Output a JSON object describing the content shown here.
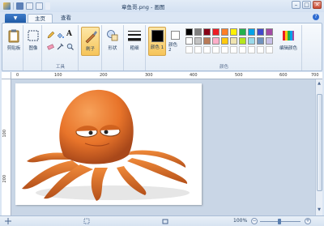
{
  "window": {
    "title": "章鱼哥.png - 画图",
    "minimize": "–",
    "maximize": "□",
    "close": "✕"
  },
  "ribbon_tabs": {
    "app_menu": "▼",
    "tabs": [
      "主页",
      "查看"
    ],
    "active": "主页",
    "help": "?"
  },
  "ribbon": {
    "clipboard": {
      "label": "剪贴板"
    },
    "image": {
      "label": "图像"
    },
    "tools": {
      "group_label": "工具",
      "text_tool": "A"
    },
    "brushes": {
      "label": "刷子"
    },
    "shapes": {
      "label": "形状"
    },
    "size": {
      "label": "粗细"
    },
    "color1": {
      "label": "颜色 1",
      "value": "#000000"
    },
    "color2": {
      "label": "颜色 2",
      "value": "#ffffff"
    },
    "colors_group_label": "颜色",
    "edit_colors": {
      "label": "编辑颜色"
    },
    "palette_row1": [
      "#000000",
      "#7f7f7f",
      "#880015",
      "#ed1c24",
      "#ff7f27",
      "#fff200",
      "#22b14c",
      "#00a2e8",
      "#3f48cc",
      "#a349a4"
    ],
    "palette_row2": [
      "#ffffff",
      "#c3c3c3",
      "#b97a57",
      "#ffaec9",
      "#ffc90e",
      "#efe4b0",
      "#b5e61d",
      "#99d9ea",
      "#7092be",
      "#c8bfe7"
    ]
  },
  "rulers": {
    "horizontal": [
      "0",
      "100",
      "200",
      "300",
      "400",
      "500",
      "600",
      "700"
    ],
    "vertical": [
      "100",
      "200"
    ]
  },
  "status": {
    "zoom": "100%",
    "zoom_out": "−",
    "zoom_in": "+"
  },
  "colors": {
    "octopus": "#e8742a",
    "octopus_dark": "#b4501a",
    "ribbon_accent": "#2c6ad0"
  }
}
